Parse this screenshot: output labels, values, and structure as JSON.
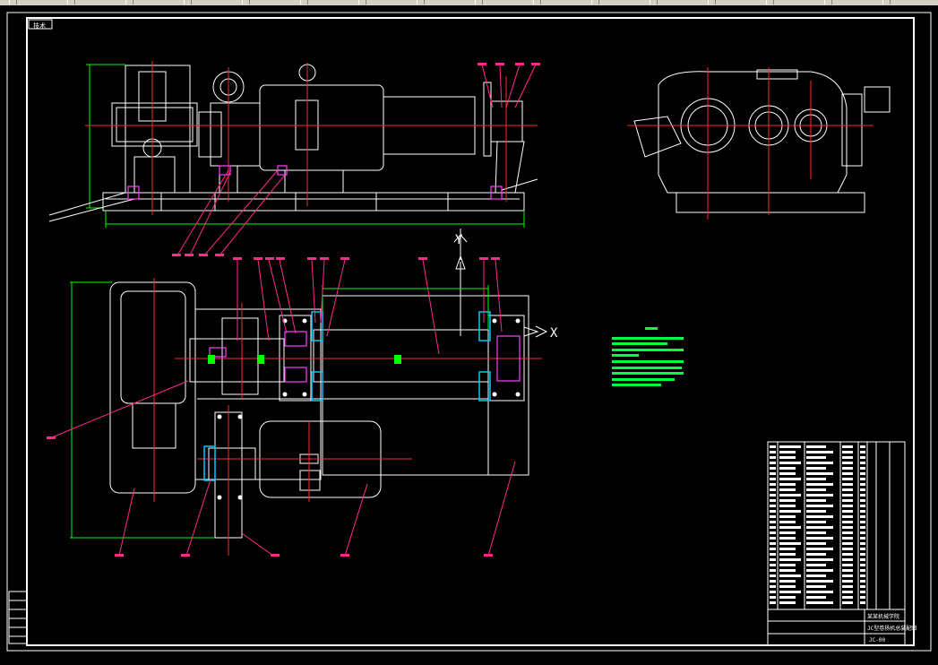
{
  "window": {
    "toolbar_buttons": 16
  },
  "drawing": {
    "frame_tag": "技术",
    "axis_labels": {
      "y": "Y",
      "x": "X"
    },
    "background": "#000000",
    "colors": {
      "outline": "#ffffff",
      "centerline": "#ff2a2a",
      "dimension": "#00ff00",
      "leader": "#ff2a8a",
      "hatch": "#00c8ff",
      "part_accent": "#ff40ff",
      "notes": "#00ff40"
    },
    "title_block": {
      "company": "某某机械学院",
      "drawing_name": "JC型卷扬机总装配图",
      "drawing_no": "JC-00"
    }
  }
}
